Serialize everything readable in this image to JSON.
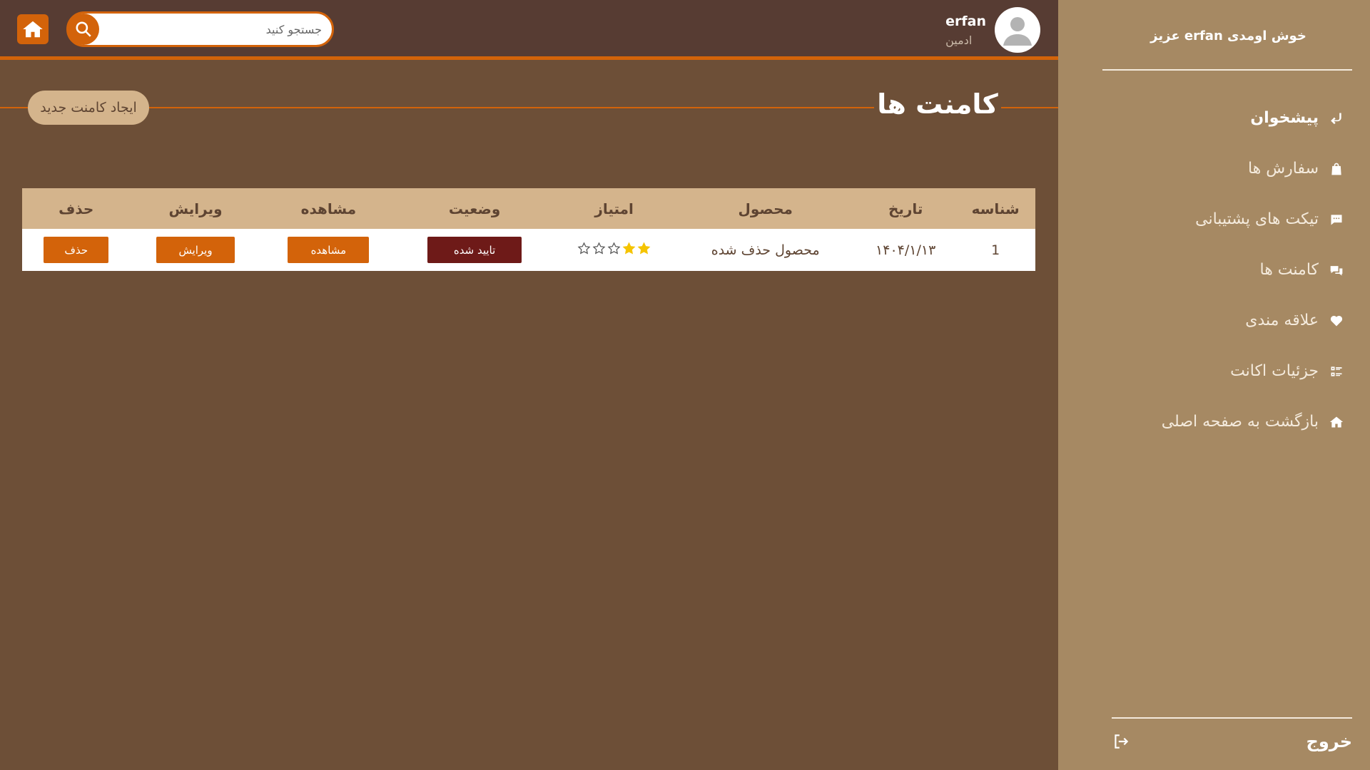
{
  "sidebar": {
    "welcome": "خوش اومدی erfan عزیز",
    "items": [
      {
        "label": "پیشخوان",
        "icon": "reply-arrow-icon",
        "active": true
      },
      {
        "label": "سفارش ها",
        "icon": "shopping-bag-icon",
        "active": false
      },
      {
        "label": "تیکت های پشتیبانی",
        "icon": "chat-bubble-icon",
        "active": false
      },
      {
        "label": "کامنت ها",
        "icon": "comments-icon",
        "active": false
      },
      {
        "label": "علاقه مندی",
        "icon": "heart-icon",
        "active": false
      },
      {
        "label": "جزئیات اکانت",
        "icon": "list-details-icon",
        "active": false
      },
      {
        "label": "بازگشت به صفحه اصلی",
        "icon": "home-icon",
        "active": false
      }
    ],
    "logout_label": "خروج"
  },
  "header": {
    "search_placeholder": "جستجو کنید",
    "user_name": "erfan",
    "user_role": "ادمین"
  },
  "main": {
    "title": "کامنت ها",
    "new_button": "ایجاد کامنت جدید",
    "table": {
      "columns": [
        "شناسه",
        "تاریخ",
        "محصول",
        "امتیاز",
        "وضعیت",
        "مشاهده",
        "ویرایش",
        "حذف"
      ],
      "rows": [
        {
          "id": "1",
          "date": "۱۴۰۴/۱/۱۳",
          "product": "محصول حذف شده",
          "rating": 2,
          "rating_max": 5,
          "status": "تایید شده",
          "view": "مشاهده",
          "edit": "ویرایش",
          "delete": "حذف"
        }
      ]
    }
  },
  "colors": {
    "accent": "#d3630a",
    "sidebar_bg": "#a68963",
    "topbar_bg": "#573c33",
    "content_bg": "#6d4f37",
    "table_header_bg": "#d4b48c",
    "status_bg": "#6e1a18",
    "star_filled": "#f5c400"
  }
}
